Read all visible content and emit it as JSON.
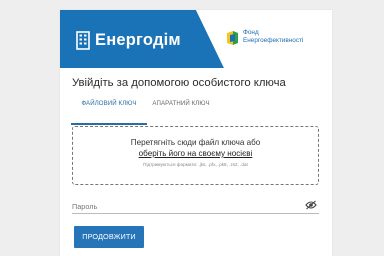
{
  "brand": {
    "name": "Енергодім",
    "partner_line1": "Фонд",
    "partner_line2": "Енергоефективності",
    "colors": {
      "banner": "#1a73b6",
      "banner_light": "#ffffff",
      "accent": "#2675b8"
    }
  },
  "page": {
    "title": "Увійдіть за допомогою особистого ключа"
  },
  "tabs": [
    {
      "label": "ФАЙЛОВИЙ КЛЮЧ",
      "active": true
    },
    {
      "label": "АПАРАТНИЙ КЛЮЧ",
      "active": false
    }
  ],
  "dropzone": {
    "line1": "Перетягніть сюди файл ключа або",
    "link": "оберіть його на своєму носієві",
    "formats": "Підтримуються формати: .jks, .pfx, .pk8, .zs2, .dat"
  },
  "password": {
    "placeholder": "Пароль",
    "toggle_icon": "eye-off-icon"
  },
  "actions": {
    "continue_label": "ПРОДОВЖИТИ"
  }
}
